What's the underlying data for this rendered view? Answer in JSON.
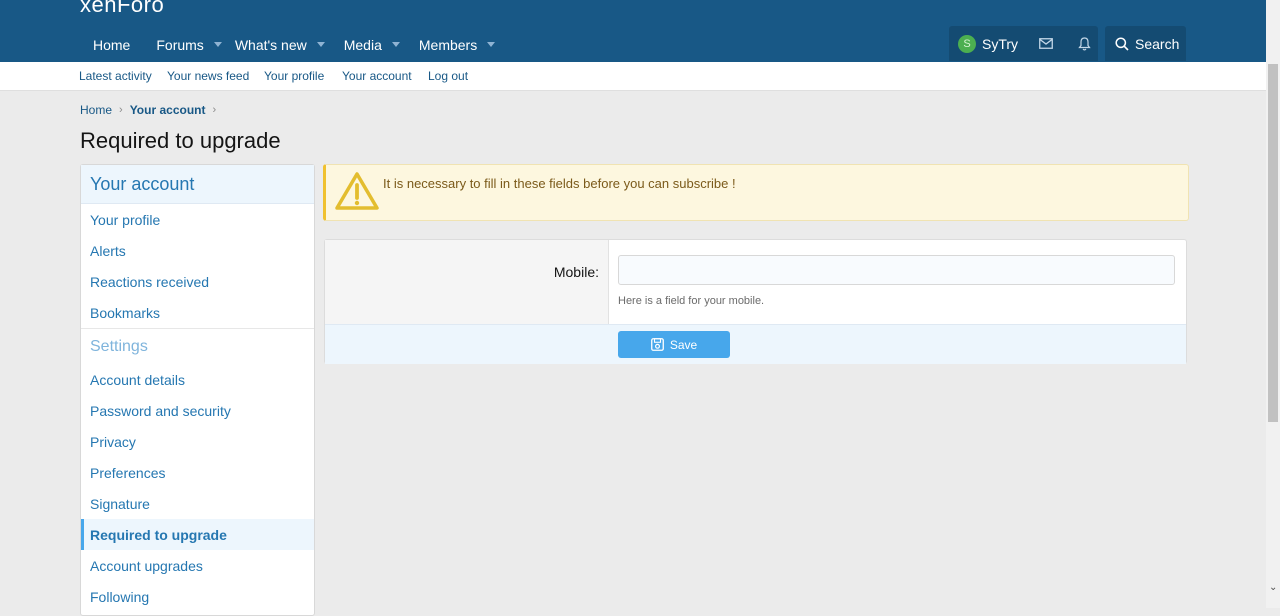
{
  "header": {
    "logo": "xenForo",
    "nav": [
      {
        "label": "Home",
        "has_caret": false
      },
      {
        "label": "Forums",
        "has_caret": true
      },
      {
        "label": "What's new",
        "has_caret": true
      },
      {
        "label": "Media",
        "has_caret": true
      },
      {
        "label": "Members",
        "has_caret": true
      }
    ],
    "user": {
      "initial": "S",
      "name": "SyTry"
    },
    "search_label": "Search"
  },
  "subnav": [
    "Latest activity",
    "Your news feed",
    "Your profile",
    "Your account",
    "Log out"
  ],
  "breadcrumb": [
    "Home",
    "Your account"
  ],
  "page_title": "Required to upgrade",
  "sidebar": {
    "heading": "Your account",
    "items_top": [
      "Your profile",
      "Alerts",
      "Reactions received",
      "Bookmarks"
    ],
    "settings_heading": "Settings",
    "items_settings": [
      "Account details",
      "Password and security",
      "Privacy",
      "Preferences",
      "Signature",
      "Required to upgrade",
      "Account upgrades",
      "Following"
    ],
    "active_item": "Required to upgrade"
  },
  "warning": {
    "text": "It is necessary to fill in these fields before you can subscribe !"
  },
  "form": {
    "label": "Mobile:",
    "value": "",
    "hint": "Here is a field for your mobile.",
    "save_label": "Save"
  },
  "colors": {
    "header_bg": "#185886",
    "link": "#2577b1",
    "button": "#47a7eb",
    "warning_bg": "#fdf7df"
  }
}
